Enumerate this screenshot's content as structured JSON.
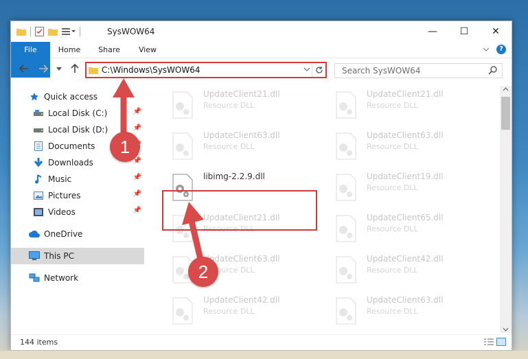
{
  "window": {
    "title": "SysWOW64",
    "minimize": "—",
    "maximize": "☐",
    "close": "✕"
  },
  "ribbon": {
    "tabs": [
      "File",
      "Home",
      "Share",
      "View"
    ],
    "help": "?"
  },
  "address": {
    "path": "C:\\Windows\\SysWOW64"
  },
  "search": {
    "placeholder": "Search SysWOW64"
  },
  "sidebar": [
    {
      "label": "Quick access"
    },
    {
      "label": "Local Disk (C:)",
      "pinned": true
    },
    {
      "label": "Local Disk (D:)",
      "pinned": true
    },
    {
      "label": "Documents",
      "pinned": true
    },
    {
      "label": "Downloads",
      "pinned": true
    },
    {
      "label": "Music",
      "pinned": true
    },
    {
      "label": "Pictures",
      "pinned": true
    },
    {
      "label": "Videos",
      "pinned": true
    },
    {
      "label": "OneDrive"
    },
    {
      "label": "This PC",
      "selected": true
    },
    {
      "label": "Network"
    }
  ],
  "files": [
    {
      "name": "UpdateClient21.dll",
      "desc": "Resource DLL"
    },
    {
      "name": "UpdateClient21.dll",
      "desc": "Resource DLL"
    },
    {
      "name": "UpdateClient63.dll",
      "desc": "Resource DLL"
    },
    {
      "name": "UpdateClient63.dll",
      "desc": "Resource DLL"
    },
    {
      "name": "libimg-2.2.9.dll",
      "desc": "",
      "highlighted": true
    },
    {
      "name": "UpdateClient19.dll",
      "desc": "Resource DLL"
    },
    {
      "name": "UpdateClient21.dll",
      "desc": "Resource DLL"
    },
    {
      "name": "UpdateClient65.dll",
      "desc": "Resource DLL"
    },
    {
      "name": "UpdateClient63.dll",
      "desc": "Resource DLL"
    },
    {
      "name": "UpdateClient42.dll",
      "desc": "Resource DLL"
    },
    {
      "name": "UpdateClient42.dll",
      "desc": "Resource DLL"
    },
    {
      "name": "UpdateClient63.dll",
      "desc": "Resource DLL"
    }
  ],
  "status": {
    "count": "144 items"
  },
  "callouts": [
    {
      "number": "1"
    },
    {
      "number": "2"
    }
  ],
  "colors": {
    "accent": "#1979ca",
    "highlight": "#d23a3a",
    "callout": "#d94b4b"
  }
}
